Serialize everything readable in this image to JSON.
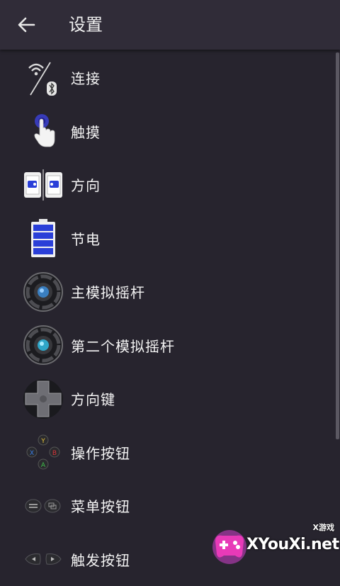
{
  "header": {
    "title": "设置",
    "back_icon": "arrow-back-icon"
  },
  "settings": {
    "items": [
      {
        "label": "连接",
        "icon": "wifi-bluetooth-icon"
      },
      {
        "label": "触摸",
        "icon": "touch-hand-icon"
      },
      {
        "label": "方向",
        "icon": "orientation-icon"
      },
      {
        "label": "节电",
        "icon": "battery-icon"
      },
      {
        "label": "主模拟摇杆",
        "icon": "analog-stick-icon"
      },
      {
        "label": "第二个模拟摇杆",
        "icon": "second-analog-stick-icon"
      },
      {
        "label": "方向键",
        "icon": "dpad-icon"
      },
      {
        "label": "操作按钮",
        "icon": "action-buttons-icon"
      },
      {
        "label": "菜单按钮",
        "icon": "menu-buttons-icon"
      },
      {
        "label": "触发按钮",
        "icon": "trigger-buttons-icon"
      }
    ]
  },
  "watermark": {
    "brand": "XYouXi.net",
    "tag": "X游戏"
  },
  "colors": {
    "background": "#27242e",
    "appbar": "#302c38",
    "accent": "#2a3fd8"
  }
}
